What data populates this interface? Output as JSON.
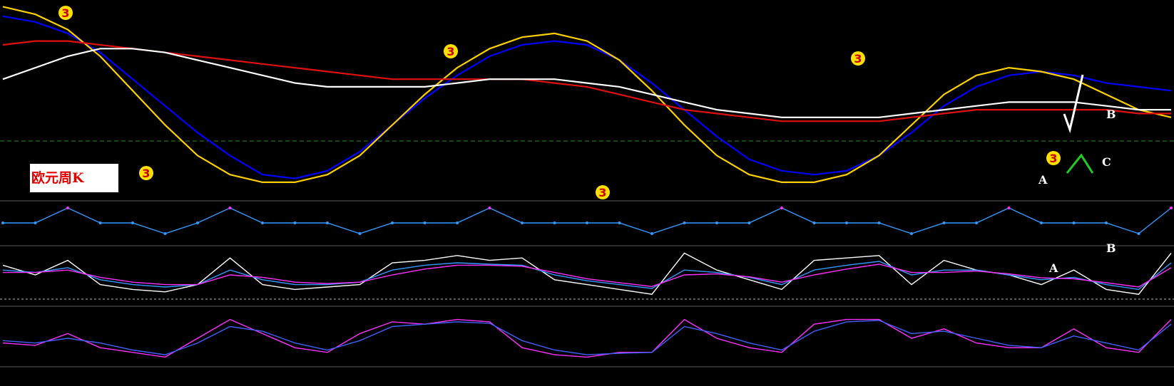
{
  "chart_data": {
    "type": "line",
    "title": "欧元周K",
    "symbol_label": "欧元周K",
    "panels": [
      {
        "name": "price",
        "series": [
          {
            "color": "#0000ff",
            "values": [
              0.93,
              0.9,
              0.84,
              0.74,
              0.6,
              0.46,
              0.32,
              0.2,
              0.1,
              0.08,
              0.12,
              0.22,
              0.36,
              0.5,
              0.62,
              0.72,
              0.78,
              0.8,
              0.78,
              0.7,
              0.58,
              0.44,
              0.3,
              0.18,
              0.12,
              0.1,
              0.12,
              0.2,
              0.32,
              0.46,
              0.56,
              0.62,
              0.64,
              0.62,
              0.58,
              0.56,
              0.54
            ]
          },
          {
            "color": "#ffd000",
            "values": [
              0.98,
              0.94,
              0.86,
              0.72,
              0.54,
              0.36,
              0.2,
              0.1,
              0.06,
              0.06,
              0.1,
              0.2,
              0.36,
              0.52,
              0.66,
              0.76,
              0.82,
              0.84,
              0.8,
              0.7,
              0.54,
              0.36,
              0.2,
              0.1,
              0.06,
              0.06,
              0.1,
              0.2,
              0.36,
              0.52,
              0.62,
              0.66,
              0.64,
              0.6,
              0.52,
              0.44,
              0.4
            ]
          },
          {
            "color": "#e01010",
            "values": [
              0.78,
              0.8,
              0.8,
              0.78,
              0.76,
              0.74,
              0.72,
              0.7,
              0.68,
              0.66,
              0.64,
              0.62,
              0.6,
              0.6,
              0.6,
              0.6,
              0.6,
              0.58,
              0.56,
              0.52,
              0.48,
              0.44,
              0.42,
              0.4,
              0.38,
              0.38,
              0.38,
              0.38,
              0.4,
              0.42,
              0.44,
              0.44,
              0.44,
              0.44,
              0.44,
              0.42,
              0.42
            ]
          },
          {
            "color": "#ffffff",
            "values": [
              0.6,
              0.66,
              0.72,
              0.76,
              0.76,
              0.74,
              0.7,
              0.66,
              0.62,
              0.58,
              0.56,
              0.56,
              0.56,
              0.56,
              0.58,
              0.6,
              0.6,
              0.6,
              0.58,
              0.56,
              0.52,
              0.48,
              0.44,
              0.42,
              0.4,
              0.4,
              0.4,
              0.4,
              0.42,
              0.44,
              0.46,
              0.48,
              0.48,
              0.48,
              0.46,
              0.44,
              0.44
            ]
          }
        ]
      },
      {
        "name": "oscillator-1",
        "series": [
          {
            "color": "#3399ff",
            "values": [
              0.3,
              0.3,
              1.0,
              0.3,
              0.3,
              -0.2,
              0.3,
              1.0,
              0.3,
              0.3,
              0.3,
              -0.2,
              0.3,
              0.3,
              0.3,
              1.0,
              0.3,
              0.3,
              0.3,
              0.3,
              -0.2,
              0.3,
              0.3,
              0.3,
              1.0,
              0.3,
              0.3,
              0.3,
              -0.2,
              0.3,
              0.3,
              1.0,
              0.3,
              0.3,
              0.3,
              -0.2,
              1.0
            ]
          }
        ]
      },
      {
        "name": "oscillator-2",
        "series": [
          {
            "color": "#ffffff",
            "values": [
              0.7,
              0.5,
              0.8,
              0.3,
              0.2,
              0.15,
              0.3,
              0.85,
              0.3,
              0.2,
              0.25,
              0.3,
              0.75,
              0.8,
              0.9,
              0.8,
              0.85,
              0.4,
              0.3,
              0.2,
              0.1,
              0.95,
              0.6,
              0.4,
              0.2,
              0.8,
              0.85,
              0.9,
              0.3,
              0.8,
              0.6,
              0.5,
              0.3,
              0.6,
              0.2,
              0.1,
              0.95
            ]
          },
          {
            "color": "#3399ff",
            "values": [
              0.6,
              0.55,
              0.65,
              0.4,
              0.3,
              0.25,
              0.3,
              0.6,
              0.4,
              0.3,
              0.3,
              0.35,
              0.6,
              0.7,
              0.75,
              0.72,
              0.7,
              0.5,
              0.38,
              0.3,
              0.22,
              0.6,
              0.55,
              0.45,
              0.3,
              0.6,
              0.7,
              0.78,
              0.5,
              0.6,
              0.6,
              0.5,
              0.4,
              0.45,
              0.3,
              0.2,
              0.75
            ]
          },
          {
            "color": "#ff30ff",
            "values": [
              0.55,
              0.55,
              0.6,
              0.45,
              0.35,
              0.3,
              0.3,
              0.5,
              0.45,
              0.35,
              0.32,
              0.35,
              0.5,
              0.62,
              0.7,
              0.7,
              0.68,
              0.55,
              0.42,
              0.34,
              0.26,
              0.5,
              0.52,
              0.46,
              0.35,
              0.5,
              0.62,
              0.72,
              0.55,
              0.55,
              0.58,
              0.52,
              0.44,
              0.42,
              0.34,
              0.25,
              0.65
            ]
          }
        ]
      },
      {
        "name": "oscillator-3",
        "series": [
          {
            "color": "#ff30ff",
            "values": [
              0.4,
              0.35,
              0.6,
              0.3,
              0.2,
              0.1,
              0.5,
              0.9,
              0.6,
              0.3,
              0.2,
              0.6,
              0.85,
              0.8,
              0.9,
              0.85,
              0.3,
              0.15,
              0.1,
              0.2,
              0.2,
              0.9,
              0.5,
              0.3,
              0.2,
              0.8,
              0.9,
              0.9,
              0.5,
              0.7,
              0.4,
              0.3,
              0.3,
              0.7,
              0.3,
              0.2,
              0.9
            ]
          },
          {
            "color": "#4060ff",
            "values": [
              0.45,
              0.4,
              0.5,
              0.4,
              0.25,
              0.15,
              0.4,
              0.75,
              0.65,
              0.4,
              0.25,
              0.45,
              0.75,
              0.8,
              0.85,
              0.82,
              0.45,
              0.25,
              0.15,
              0.18,
              0.2,
              0.75,
              0.6,
              0.4,
              0.25,
              0.65,
              0.85,
              0.88,
              0.6,
              0.65,
              0.5,
              0.35,
              0.3,
              0.55,
              0.4,
              0.25,
              0.8
            ]
          }
        ]
      }
    ],
    "annotations": [
      "A",
      "B",
      "C",
      "A",
      "B"
    ],
    "markers": [
      "3",
      "3",
      "3",
      "3",
      "3",
      "3"
    ]
  }
}
